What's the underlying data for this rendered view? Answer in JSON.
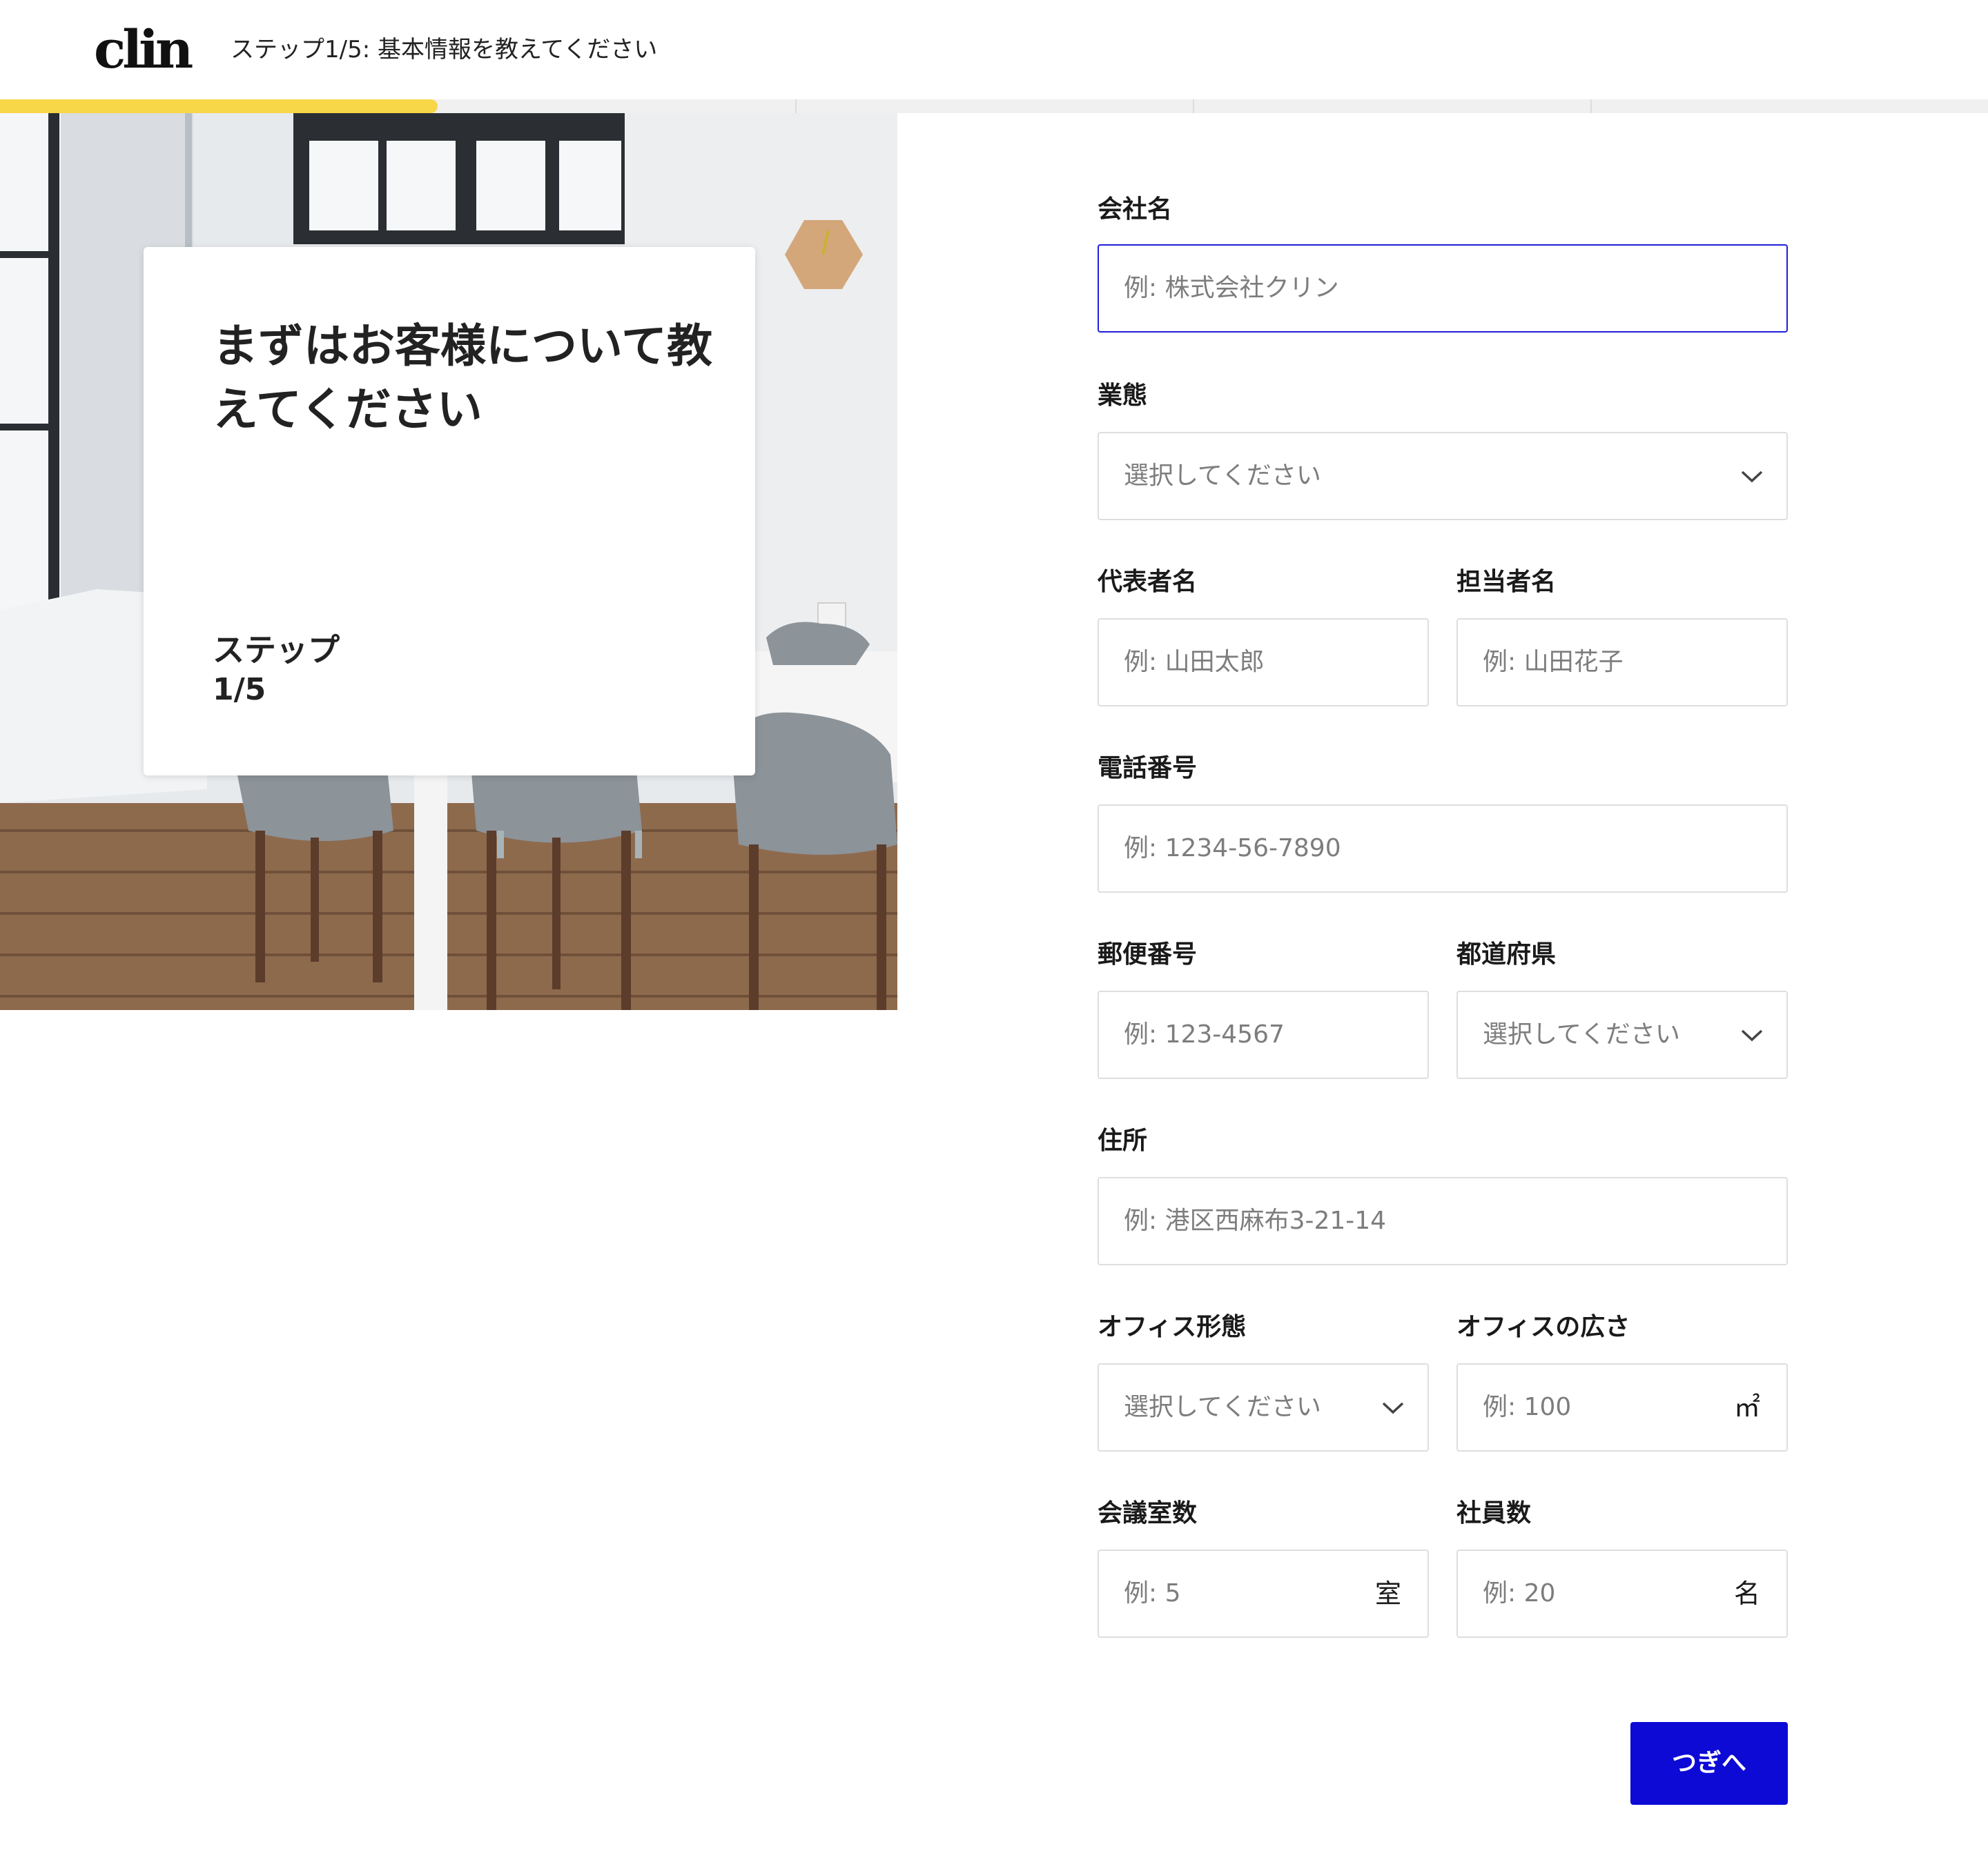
{
  "header": {
    "logo": "clin",
    "step_title": "ステップ1/5: 基本情報を教えてください"
  },
  "progress": {
    "current_step": 1,
    "total_steps": 5,
    "fraction": 0.2
  },
  "intro": {
    "heading": "まずはお客様について教えてください",
    "step_label": "ステップ",
    "step_count": "1/5"
  },
  "form": {
    "company_name": {
      "label": "会社名",
      "placeholder": "例: 株式会社クリン"
    },
    "business_type": {
      "label": "業態",
      "selected": "選択してください"
    },
    "representative": {
      "label": "代表者名",
      "placeholder": "例: 山田太郎"
    },
    "contact_person": {
      "label": "担当者名",
      "placeholder": "例: 山田花子"
    },
    "phone": {
      "label": "電話番号",
      "placeholder": "例: 1234-56-7890"
    },
    "postal_code": {
      "label": "郵便番号",
      "placeholder": "例: 123-4567"
    },
    "prefecture": {
      "label": "都道府県",
      "selected": "選択してください"
    },
    "address": {
      "label": "住所",
      "placeholder": "例: 港区西麻布3-21-14"
    },
    "office_type": {
      "label": "オフィス形態",
      "selected": "選択してください"
    },
    "office_size": {
      "label": "オフィスの広さ",
      "placeholder": "例: 100",
      "unit": "㎡"
    },
    "meeting_rooms": {
      "label": "会議室数",
      "placeholder": "例: 5",
      "unit": "室"
    },
    "employees": {
      "label": "社員数",
      "placeholder": "例: 20",
      "unit": "名"
    }
  },
  "next_button": {
    "label": "つぎへ"
  },
  "colors": {
    "accent": "#0d0ad6",
    "progress": "#f7d648",
    "focus_border": "#1f1fd8"
  }
}
